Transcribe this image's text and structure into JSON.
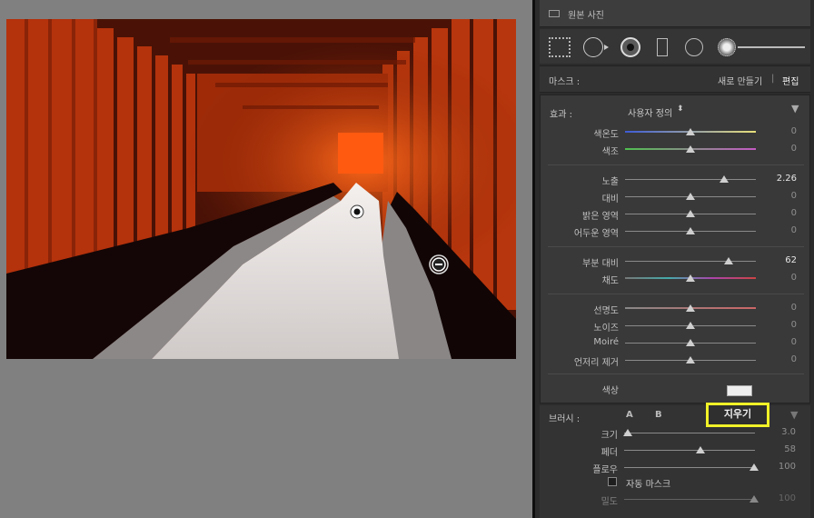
{
  "original_photo": {
    "label": "원본 사진"
  },
  "tools": [
    "crop-overlay-icon",
    "spot-removal-icon",
    "red-eye-icon",
    "graduated-filter-icon",
    "radial-filter-icon",
    "adjustment-brush-icon"
  ],
  "mask": {
    "label": "마스크 :",
    "new_label": "새로 만들기",
    "separator": "|",
    "edit_label": "편집"
  },
  "effects": {
    "label": "효과 :",
    "preset": "사용자 정의",
    "preset_arrow": "⬍",
    "collapse": "▼",
    "groups": [
      [
        {
          "name": "색온도",
          "value": "0",
          "pos": 0.5,
          "track": "temp"
        },
        {
          "name": "색조",
          "value": "0",
          "pos": 0.5,
          "track": "tint"
        }
      ],
      [
        {
          "name": "노출",
          "value": "2.26",
          "pos": 0.76,
          "active": true
        },
        {
          "name": "대비",
          "value": "0",
          "pos": 0.5
        },
        {
          "name": "밝은 영역",
          "value": "0",
          "pos": 0.5
        },
        {
          "name": "어두운 영역",
          "value": "0",
          "pos": 0.5
        }
      ],
      [
        {
          "name": "부분 대비",
          "value": "62",
          "pos": 0.79,
          "active": true
        },
        {
          "name": "채도",
          "value": "0",
          "pos": 0.5,
          "track": "sat"
        }
      ],
      [
        {
          "name": "선명도",
          "value": "0",
          "pos": 0.5,
          "track": "sharp"
        },
        {
          "name": "노이즈",
          "value": "0",
          "pos": 0.5
        },
        {
          "name": "Moiré",
          "value": "0",
          "pos": 0.5
        },
        {
          "name": "언저리 제거",
          "value": "0",
          "pos": 0.5
        }
      ]
    ],
    "color_label": "색상"
  },
  "brush": {
    "label": "브러시 :",
    "a": "A",
    "b": "B",
    "erase": "지우기",
    "collapse": "▼",
    "sliders": [
      {
        "name": "크기",
        "value": "3.0",
        "pos": 0.03
      },
      {
        "name": "페더",
        "value": "58",
        "pos": 0.58
      },
      {
        "name": "플로우",
        "value": "100",
        "pos": 0.99
      }
    ],
    "auto_mask_label": "자동 마스크",
    "density": {
      "name": "밀도",
      "value": "100",
      "pos": 0.99
    }
  },
  "colors": {
    "panel_bg": "#393939",
    "highlight": "#f2f228",
    "torii_red": "#c2400f"
  }
}
